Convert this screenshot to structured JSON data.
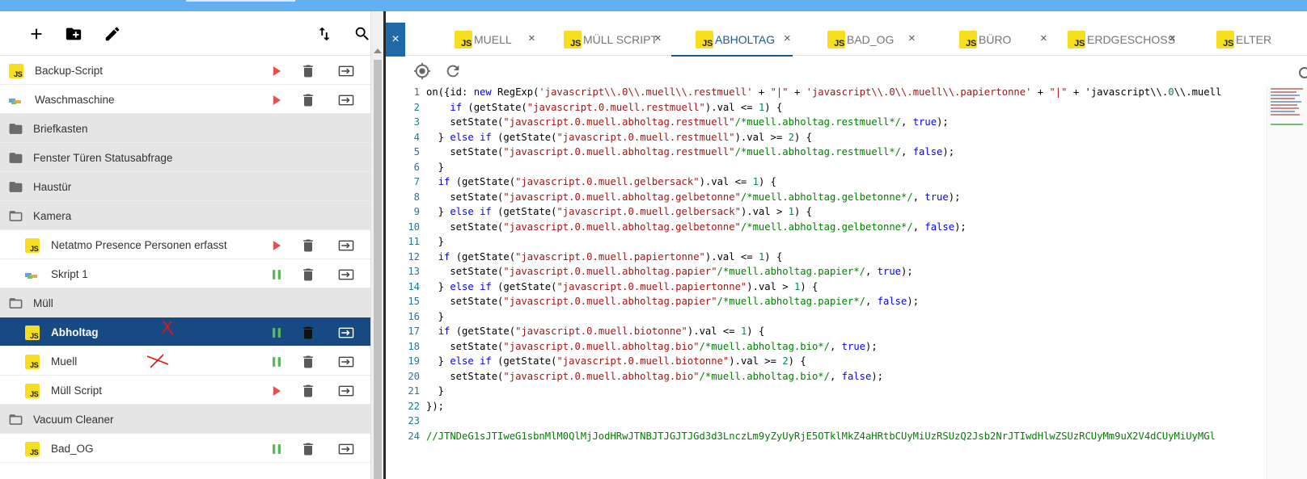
{
  "toolbar": {
    "add_icon": "plus-icon",
    "add_folder_icon": "folder-plus-icon",
    "edit_icon": "pencil-icon",
    "sort_icon": "sort-icon",
    "search_icon": "search-icon"
  },
  "sidebar": {
    "items": [
      {
        "type": "js",
        "label": "Backup-Script",
        "state": "stopped"
      },
      {
        "type": "blockly",
        "label": "Waschmaschine",
        "state": "stopped"
      },
      {
        "type": "folder",
        "label": "Briefkasten"
      },
      {
        "type": "folder",
        "label": "Fenster Türen Statusabfrage"
      },
      {
        "type": "folder",
        "label": "Haustür"
      },
      {
        "type": "folder-open",
        "label": "Kamera"
      },
      {
        "type": "js",
        "label": "Netatmo Presence Personen erfasst",
        "state": "stopped"
      },
      {
        "type": "blockly",
        "label": "Skript 1",
        "state": "running"
      },
      {
        "type": "folder-open",
        "label": "Müll"
      },
      {
        "type": "js",
        "label": "Abholtag",
        "state": "running",
        "selected": true
      },
      {
        "type": "js",
        "label": "Muell",
        "state": "running"
      },
      {
        "type": "js",
        "label": "Müll Script",
        "state": "stopped"
      },
      {
        "type": "folder-open",
        "label": "Vacuum Cleaner"
      },
      {
        "type": "js",
        "label": "Bad_OG",
        "state": "running"
      }
    ]
  },
  "tabs": [
    {
      "label": "MUELL",
      "active": false
    },
    {
      "label": "MÜLL SCRIPT",
      "active": false
    },
    {
      "label": "ABHOLTAG",
      "active": true
    },
    {
      "label": "BAD_OG",
      "active": false
    },
    {
      "label": "BÜRO",
      "active": false
    },
    {
      "label": "ERDGESCHOSS",
      "active": false
    },
    {
      "label": "ELTER",
      "active": false
    }
  ],
  "js_badge_text": "JS",
  "close_glyph": "×",
  "editor": {
    "lines": [
      {
        "n": "1",
        "text": "on({id: new RegExp('javascript\\\\.0\\\\.muell\\\\.restmuell' + \"|\" + 'javascript\\\\.0\\\\.muell\\\\.papiertonne' + \"|\" + 'javascript\\\\.0\\\\.muell"
      },
      {
        "n": "2",
        "text": "    if (getState(\"javascript.0.muell.restmuell\").val <= 1) {"
      },
      {
        "n": "3",
        "text": "    setState(\"javascript.0.muell.abholtag.restmuell\"/*muell.abholtag.restmuell*/, true);"
      },
      {
        "n": "4",
        "text": "  } else if (getState(\"javascript.0.muell.restmuell\").val >= 2) {"
      },
      {
        "n": "5",
        "text": "    setState(\"javascript.0.muell.abholtag.restmuell\"/*muell.abholtag.restmuell*/, false);"
      },
      {
        "n": "6",
        "text": "  }"
      },
      {
        "n": "7",
        "text": "  if (getState(\"javascript.0.muell.gelbersack\").val <= 1) {"
      },
      {
        "n": "8",
        "text": "    setState(\"javascript.0.muell.abholtag.gelbetonne\"/*muell.abholtag.gelbetonne*/, true);"
      },
      {
        "n": "9",
        "text": "  } else if (getState(\"javascript.0.muell.gelbersack\").val > 1) {"
      },
      {
        "n": "10",
        "text": "    setState(\"javascript.0.muell.abholtag.gelbetonne\"/*muell.abholtag.gelbetonne*/, false);"
      },
      {
        "n": "11",
        "text": "  }"
      },
      {
        "n": "12",
        "text": "  if (getState(\"javascript.0.muell.papiertonne\").val <= 1) {"
      },
      {
        "n": "13",
        "text": "    setState(\"javascript.0.muell.abholtag.papier\"/*muell.abholtag.papier*/, true);"
      },
      {
        "n": "14",
        "text": "  } else if (getState(\"javascript.0.muell.papiertonne\").val > 1) {"
      },
      {
        "n": "15",
        "text": "    setState(\"javascript.0.muell.abholtag.papier\"/*muell.abholtag.papier*/, false);"
      },
      {
        "n": "16",
        "text": "  }"
      },
      {
        "n": "17",
        "text": "  if (getState(\"javascript.0.muell.biotonne\").val <= 1) {"
      },
      {
        "n": "18",
        "text": "    setState(\"javascript.0.muell.abholtag.bio\"/*muell.abholtag.bio*/, true);"
      },
      {
        "n": "19",
        "text": "  } else if (getState(\"javascript.0.muell.biotonne\").val >= 2) {"
      },
      {
        "n": "20",
        "text": "    setState(\"javascript.0.muell.abholtag.bio\"/*muell.abholtag.bio*/, false);"
      },
      {
        "n": "21",
        "text": "  }"
      },
      {
        "n": "22",
        "text": "});"
      },
      {
        "n": "23",
        "text": ""
      },
      {
        "n": "24",
        "text": "//JTNDeG1sJTIweG1sbnMlM0QlMjJodHRwJTNBJTJGJTJGd3d3LnczLm9yZyUyRjE5OTklMkZ4aHRtbCUyMiUzRSUzQ2Jsb2NrJTIwdHlwZSUzRCUyMm9uX2V4dCUyMiUyMGl"
      }
    ]
  },
  "colors": {
    "topbar": "#62b0f2",
    "selected_row": "#174a82",
    "folder_row": "#e5e5e5",
    "run_icon": "#e94f4f",
    "pause_icon": "#5bb85b",
    "js_badge": "#f7df1e",
    "active_tab": "#1e5a8c",
    "line_number": "#237893"
  }
}
